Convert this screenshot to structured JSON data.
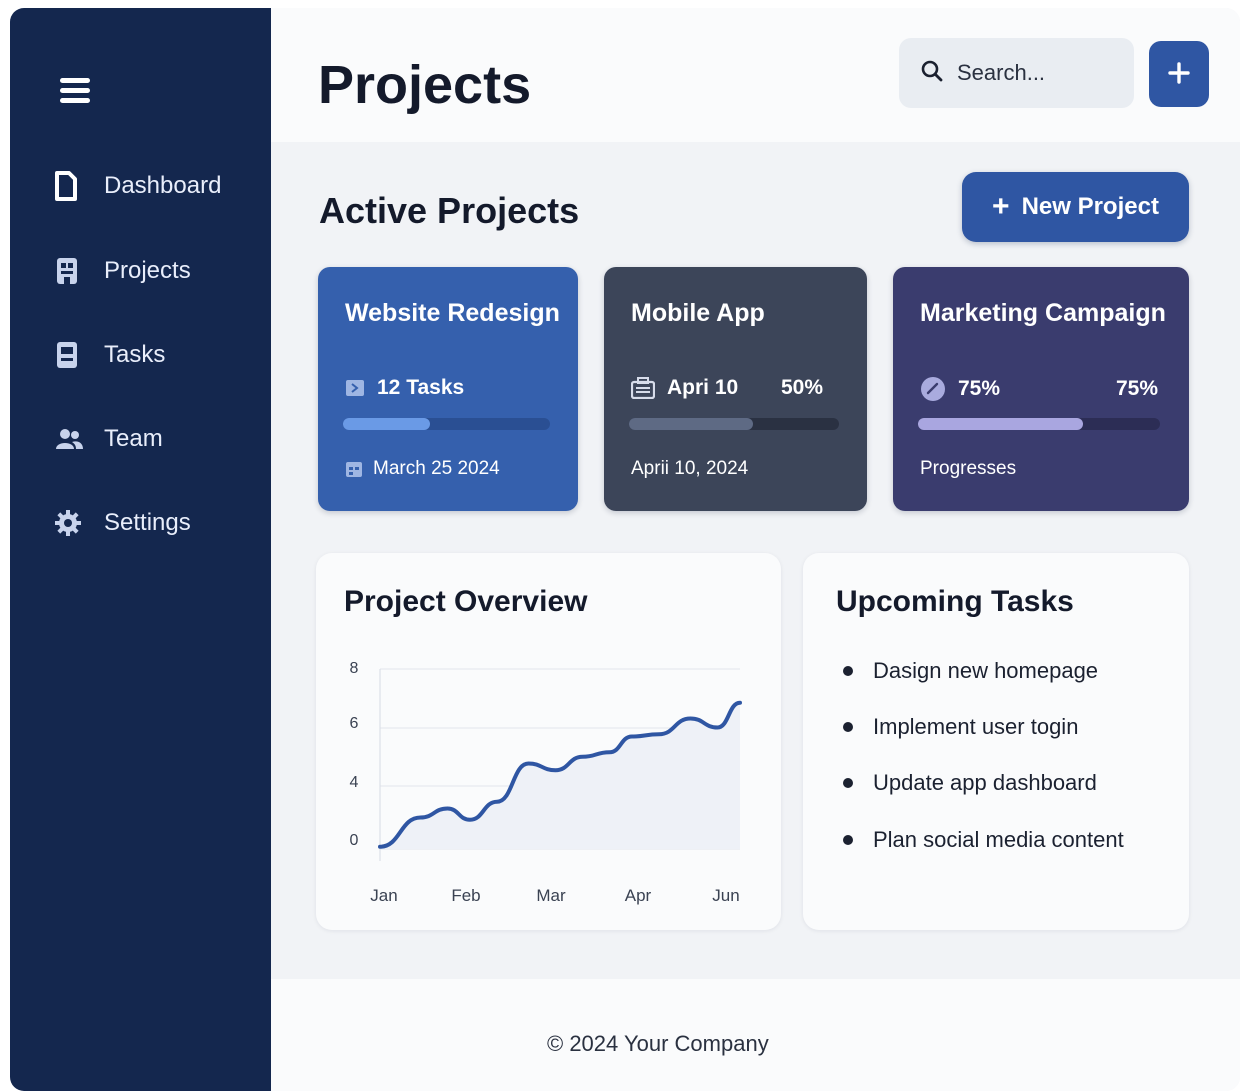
{
  "sidebar": {
    "items": [
      {
        "label": "Dashboard",
        "icon": "document-icon"
      },
      {
        "label": "Projects",
        "icon": "projects-icon"
      },
      {
        "label": "Tasks",
        "icon": "tasks-icon"
      },
      {
        "label": "Team",
        "icon": "team-icon"
      },
      {
        "label": "Settings",
        "icon": "gear-icon"
      }
    ]
  },
  "header": {
    "title": "Projects",
    "search_placeholder": "Search...",
    "add_icon": "plus-icon"
  },
  "active": {
    "title": "Active Projects",
    "new_button": "New Project"
  },
  "cards": [
    {
      "title": "Website Redesign",
      "meta": "12 Tasks",
      "progress": 0.42,
      "footer": "March 25 2024",
      "color": "#3560ad"
    },
    {
      "title": "Mobile App",
      "meta": "Apri 10",
      "value": "50%",
      "progress": 0.59,
      "footer": "Aprii 10, 2024",
      "color": "#3c4559"
    },
    {
      "title": "Marketing Campaign",
      "meta": "75%",
      "value": "75%",
      "progress": 0.68,
      "footer": "Progresses",
      "color": "#3a3c6e"
    }
  ],
  "overview": {
    "title": "Project Overview",
    "chart_data": {
      "type": "line",
      "title": "Project Overview",
      "x": [
        "Jan",
        "Feb",
        "Mar",
        "Apr",
        "Jun"
      ],
      "yticks": [
        0,
        2,
        4,
        6,
        8
      ],
      "ytick_labels": [
        "0",
        "4",
        "6",
        "8"
      ],
      "ylim": [
        0,
        8
      ],
      "grid": true,
      "series": [
        {
          "points": [
            [
              0.0,
              0.1
            ],
            [
              0.45,
              1.4
            ],
            [
              0.75,
              1.8
            ],
            [
              1.0,
              1.3
            ],
            [
              1.3,
              2.1
            ],
            [
              1.65,
              3.8
            ],
            [
              1.95,
              3.5
            ],
            [
              2.25,
              4.1
            ],
            [
              2.55,
              4.3
            ],
            [
              2.8,
              5.0
            ],
            [
              3.1,
              5.1
            ],
            [
              3.45,
              5.8
            ],
            [
              3.75,
              5.4
            ],
            [
              4.0,
              6.5
            ]
          ],
          "color": "#2f56a3"
        }
      ]
    }
  },
  "upcoming": {
    "title": "Upcoming Tasks",
    "items": [
      "Dasign new homepage",
      "Implement user togin",
      "Update app dashboard",
      "Plan social media content"
    ]
  },
  "footer": {
    "text": "© 2024 Your Company"
  }
}
